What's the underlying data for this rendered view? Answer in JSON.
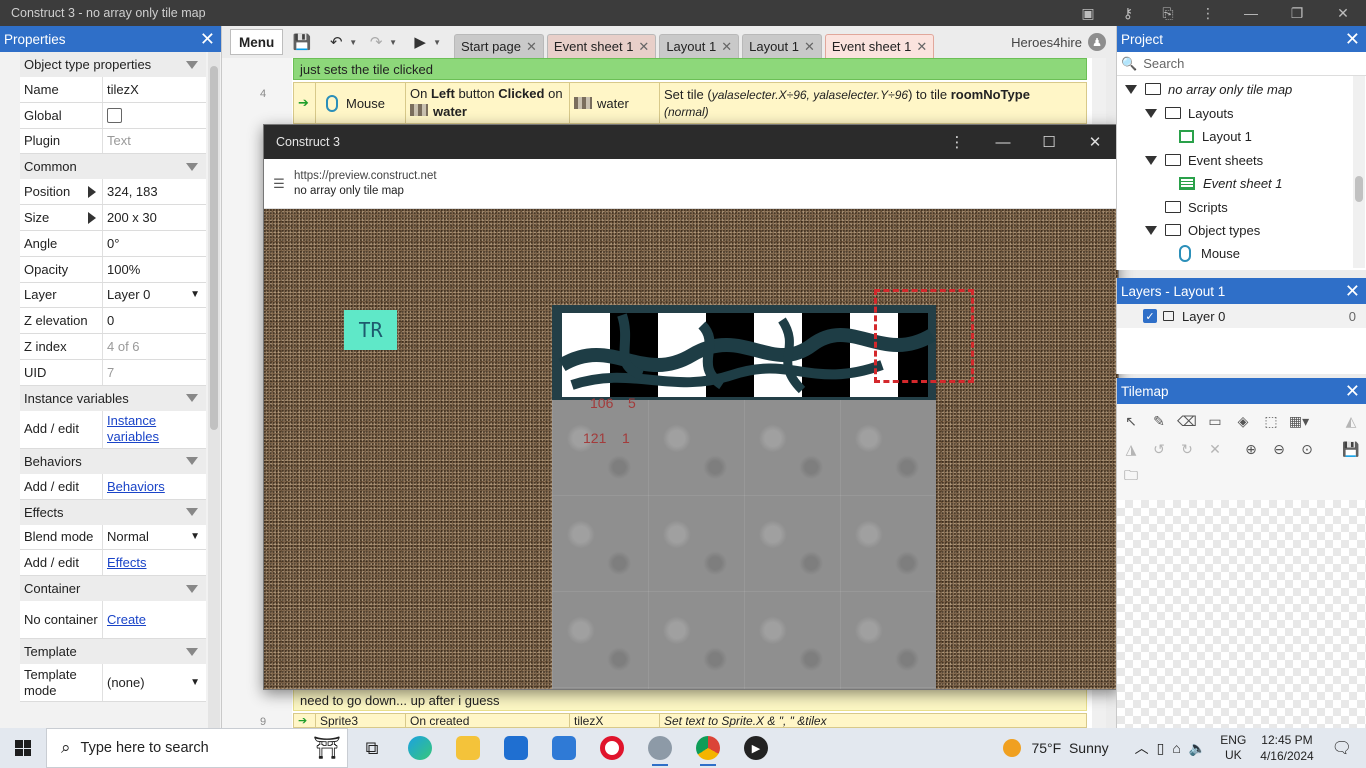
{
  "window": {
    "title": "Construct 3 - no array only tile map"
  },
  "properties": {
    "title": "Properties",
    "rows": [
      {
        "type": "section",
        "label": "Object type properties"
      },
      {
        "type": "prop",
        "label": "Name",
        "value": "tilezX"
      },
      {
        "type": "check",
        "label": "Global",
        "value": ""
      },
      {
        "type": "prop",
        "label": "Plugin",
        "value": "Text",
        "muted": true
      },
      {
        "type": "section",
        "label": "Common"
      },
      {
        "type": "expand",
        "label": "Position",
        "value": "324, 183"
      },
      {
        "type": "expand",
        "label": "Size",
        "value": "200 x 30"
      },
      {
        "type": "prop",
        "label": "Angle",
        "value": "0°"
      },
      {
        "type": "prop",
        "label": "Opacity",
        "value": "100%"
      },
      {
        "type": "select",
        "label": "Layer",
        "value": "Layer 0"
      },
      {
        "type": "prop",
        "label": "Z elevation",
        "value": "0"
      },
      {
        "type": "prop",
        "label": "Z index",
        "value": "4 of 6",
        "muted": true
      },
      {
        "type": "prop",
        "label": "UID",
        "value": "7",
        "muted": true
      },
      {
        "type": "section",
        "label": "Instance variables"
      },
      {
        "type": "link2",
        "label": "Add / edit",
        "value": "Instance variables"
      },
      {
        "type": "section",
        "label": "Behaviors"
      },
      {
        "type": "link",
        "label": "Add / edit",
        "value": "Behaviors"
      },
      {
        "type": "section",
        "label": "Effects"
      },
      {
        "type": "select",
        "label": "Blend mode",
        "value": "Normal"
      },
      {
        "type": "link",
        "label": "Add / edit",
        "value": "Effects"
      },
      {
        "type": "section",
        "label": "Container"
      },
      {
        "type": "link2",
        "label": "No container",
        "value": "Create"
      },
      {
        "type": "section",
        "label": "Template"
      },
      {
        "type": "select2",
        "label": "Template mode",
        "value": "(none)"
      }
    ]
  },
  "toolbar": {
    "menu": "Menu",
    "tabs": [
      {
        "label": "Start page",
        "kind": "page"
      },
      {
        "label": "Event sheet 1",
        "kind": "event"
      },
      {
        "label": "Layout 1",
        "kind": "layout"
      },
      {
        "label": "Layout 1",
        "kind": "layout"
      },
      {
        "label": "Event sheet 1",
        "kind": "active"
      }
    ],
    "user": "Heroes4hire"
  },
  "sheet": {
    "comment_top": "just sets the tile clicked",
    "event_line": "4",
    "event": {
      "object": "Mouse",
      "condition_pre": "On",
      "condition_button": "Left",
      "condition_mid": "button",
      "condition_clicked": "Clicked",
      "condition_on": "on",
      "condition_target": "water",
      "action_object": "water",
      "action_pre": "Set tile (",
      "action_expr": "yalaselecter.X÷96, yalaselecter.Y÷96",
      "action_mid": ") to tile",
      "action_tile": "roomNoType",
      "action_flag": "(normal)"
    },
    "comment_bottom": "need to go down... up after i guess",
    "event2_line": "9",
    "event2": {
      "object": "Sprite3",
      "condition": "On created",
      "action_object": "tilezX",
      "action": "Set text to Sprite.X & \", \" &tilex"
    }
  },
  "preview": {
    "title": "Construct 3",
    "url": "https://preview.construct.net",
    "page": "no array only tile map",
    "tr_label": "TR",
    "coord_row1": [
      "106",
      "5"
    ],
    "coord_row2": [
      "121",
      "1"
    ]
  },
  "project": {
    "title": "Project",
    "search_placeholder": "Search",
    "tree": [
      {
        "label": "no array only tile map",
        "level": 0,
        "kind": "root"
      },
      {
        "label": "Layouts",
        "level": 1,
        "kind": "folder"
      },
      {
        "label": "Layout 1",
        "level": 2,
        "kind": "layout"
      },
      {
        "label": "Event sheets",
        "level": 1,
        "kind": "folder"
      },
      {
        "label": "Event sheet 1",
        "level": 2,
        "kind": "sheet"
      },
      {
        "label": "Scripts",
        "level": 1,
        "kind": "folder-empty"
      },
      {
        "label": "Object types",
        "level": 1,
        "kind": "folder"
      },
      {
        "label": "Mouse",
        "level": 2,
        "kind": "mouse"
      }
    ]
  },
  "layers": {
    "title": "Layers - Layout 1",
    "items": [
      {
        "label": "Layer 0",
        "count": "0"
      }
    ]
  },
  "tilemap": {
    "title": "Tilemap"
  },
  "taskbar": {
    "search_placeholder": "Type here to search",
    "weather_temp": "75°F",
    "weather_text": "Sunny",
    "lang1": "ENG",
    "lang2": "UK",
    "time": "12:45 PM",
    "date": "4/16/2024"
  },
  "colors": {
    "accent": "#2f6fc8",
    "comment_green": "#8dd87a",
    "event_yellow": "#fff6c7",
    "selector_red": "#d4282c"
  }
}
